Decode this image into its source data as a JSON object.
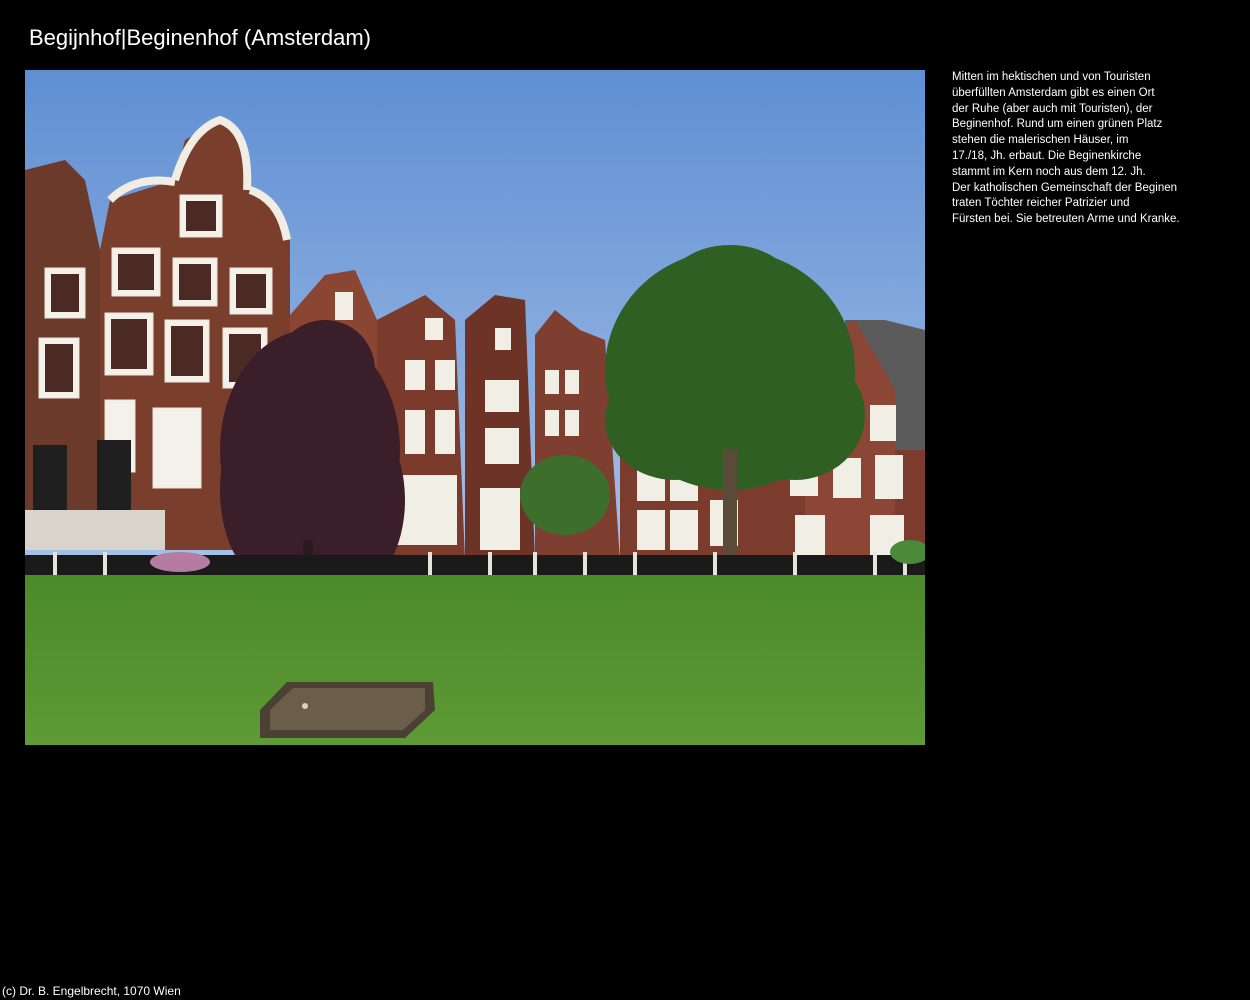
{
  "page": {
    "title": "Begijnhof|Beginenhof (Amsterdam)",
    "background_color": "#000000",
    "text_color": "#ffffff"
  },
  "photo": {
    "subject": "Begijnhof courtyard with gabled canal houses, a copper beech, a green tree and a lawn"
  },
  "description": {
    "lines": [
      "Mitten im hektischen und von Touristen",
      "überfüllten Amsterdam gibt es einen Ort",
      "der Ruhe (aber auch mit Touristen), der",
      "Beginenhof. Rund um einen grünen Platz",
      "stehen die malerischen Häuser, im",
      "17./18, Jh. erbaut. Die Beginenkirche",
      "stammt im Kern noch aus dem 12. Jh.",
      "Der katholischen Gemeinschaft der Beginen",
      "traten Töchter reicher Patrizier und",
      "Fürsten bei. Sie betreuten Arme und Kranke."
    ]
  },
  "footer": {
    "copyright": "(c) Dr. B. Engelbrecht, 1070 Wien"
  }
}
